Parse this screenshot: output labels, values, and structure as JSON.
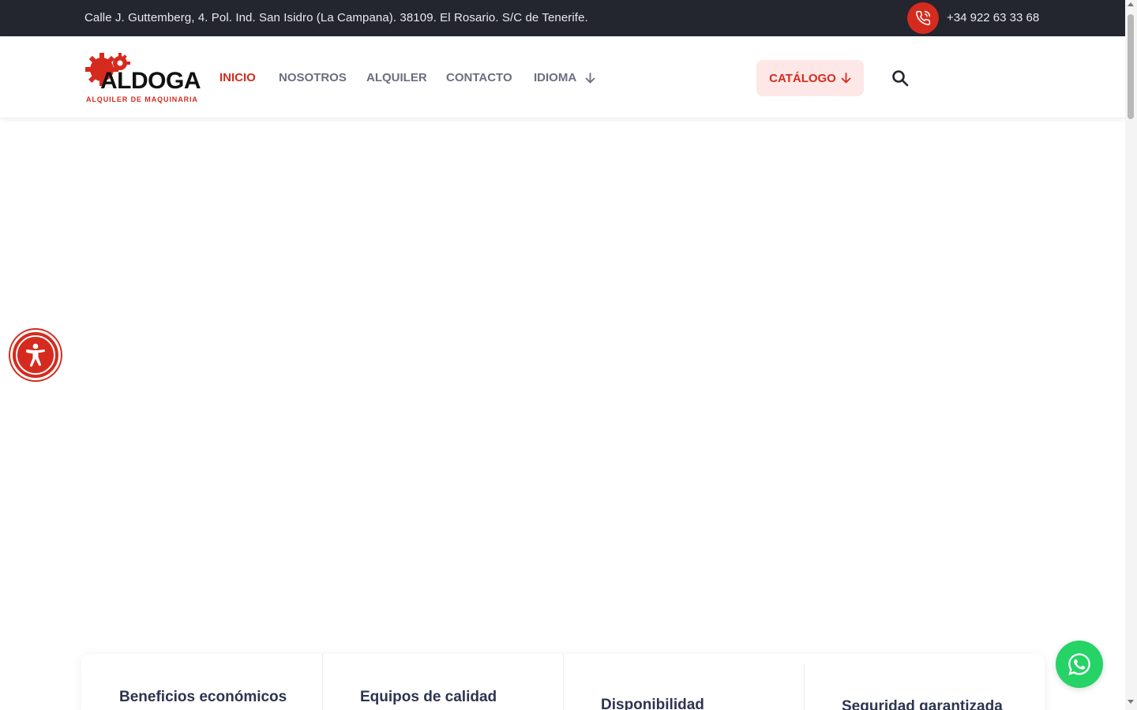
{
  "topbar": {
    "address": "Calle J. Guttemberg, 4. Pol. Ind. San Isidro (La Campana). 38109. El Rosario. S/C de Tenerife.",
    "phone": "+34 922 63 33 68",
    "phone_icon": "phone-icon"
  },
  "logo": {
    "name": "ALDOGA",
    "tagline": "ALQUILER DE MAQUINARIA",
    "icon": "gear-logo-icon"
  },
  "nav": {
    "items": [
      {
        "label": "INICIO",
        "active": true
      },
      {
        "label": "NOSOTROS",
        "active": false
      },
      {
        "label": "ALQUILER",
        "active": false
      },
      {
        "label": "CONTACTO",
        "active": false
      },
      {
        "label": "IDIOMA",
        "active": false,
        "dropdown": true
      }
    ]
  },
  "catalog_button": {
    "label": "CATÁLOGO",
    "icon": "arrow-down-icon"
  },
  "search": {
    "icon": "search-icon"
  },
  "accessibility": {
    "icon": "accessibility-icon"
  },
  "features": [
    {
      "title": "Beneficios económicos"
    },
    {
      "title": "Equipos de calidad"
    },
    {
      "title": "Disponibilidad"
    },
    {
      "title": "Seguridad garantizada"
    }
  ],
  "whatsapp": {
    "icon": "whatsapp-icon"
  },
  "colors": {
    "brand_red": "#d52b1e",
    "topbar_bg": "#23252f",
    "nav_text": "#6b6e80",
    "catalog_bg": "#fde8e7",
    "whatsapp_green": "#25d366"
  }
}
